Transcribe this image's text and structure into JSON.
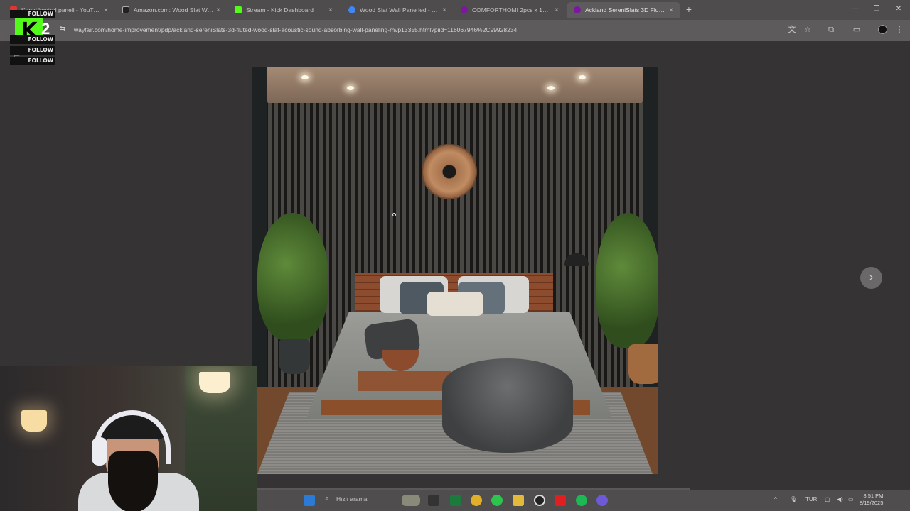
{
  "browser": {
    "tabs": [
      {
        "title": "Kanal kontrol paneli - YouTube",
        "favicon_color": "#e3342f",
        "active": false
      },
      {
        "title": "Amazon.com: Wood Slat Wall P",
        "favicon_color": "#222222",
        "active": false
      },
      {
        "title": "Stream - Kick Dashboard",
        "favicon_color": "#53fc18",
        "active": false
      },
      {
        "title": "Wood Slat Wall Pane led - Goo",
        "favicon_color": "#4285f4",
        "active": false
      },
      {
        "title": "COMFORTHOMI 2pcs x 106 x",
        "favicon_color": "#7b189f",
        "active": false
      },
      {
        "title": "Ackland SereniSlats 3D Fluted",
        "favicon_color": "#7b189f",
        "active": true
      }
    ],
    "tab_close_glyph": "×",
    "new_tab_glyph": "+",
    "window_controls": [
      "—",
      "❐",
      "✕"
    ],
    "url": "wayfair.com/home-improvement/pdp/ackland-sereniSlats-3d-fluted-wood-slat-acoustic-sound-absorbing-wall-paneling-mvp13355.html?piid=116067946%2C99928234",
    "toolbar_icons": [
      "translate-icon",
      "star-icon",
      "extensions-icon",
      "sidepanel-icon",
      "profile-icon",
      "menu-icon"
    ]
  },
  "viewer": {
    "back_glyph": "←",
    "next_glyph": "›",
    "image_alt": "Ackland SereniSlats 3D Fluted Wood Slat Acoustic Sound Absorbing Wall Paneling in a bedroom"
  },
  "kick_overlay": {
    "logo_letter": "K",
    "count": "2",
    "follow_labels": [
      "FOLLOW",
      "FOLLOW",
      "FOLLOW",
      "FOLLOW",
      "FOLLOW"
    ],
    "brand_color": "#53fc18"
  },
  "taskbar": {
    "search_placeholder": "Hızlı arama",
    "language": "TUR",
    "time": "8:51 PM",
    "date": "8/19/2025"
  }
}
